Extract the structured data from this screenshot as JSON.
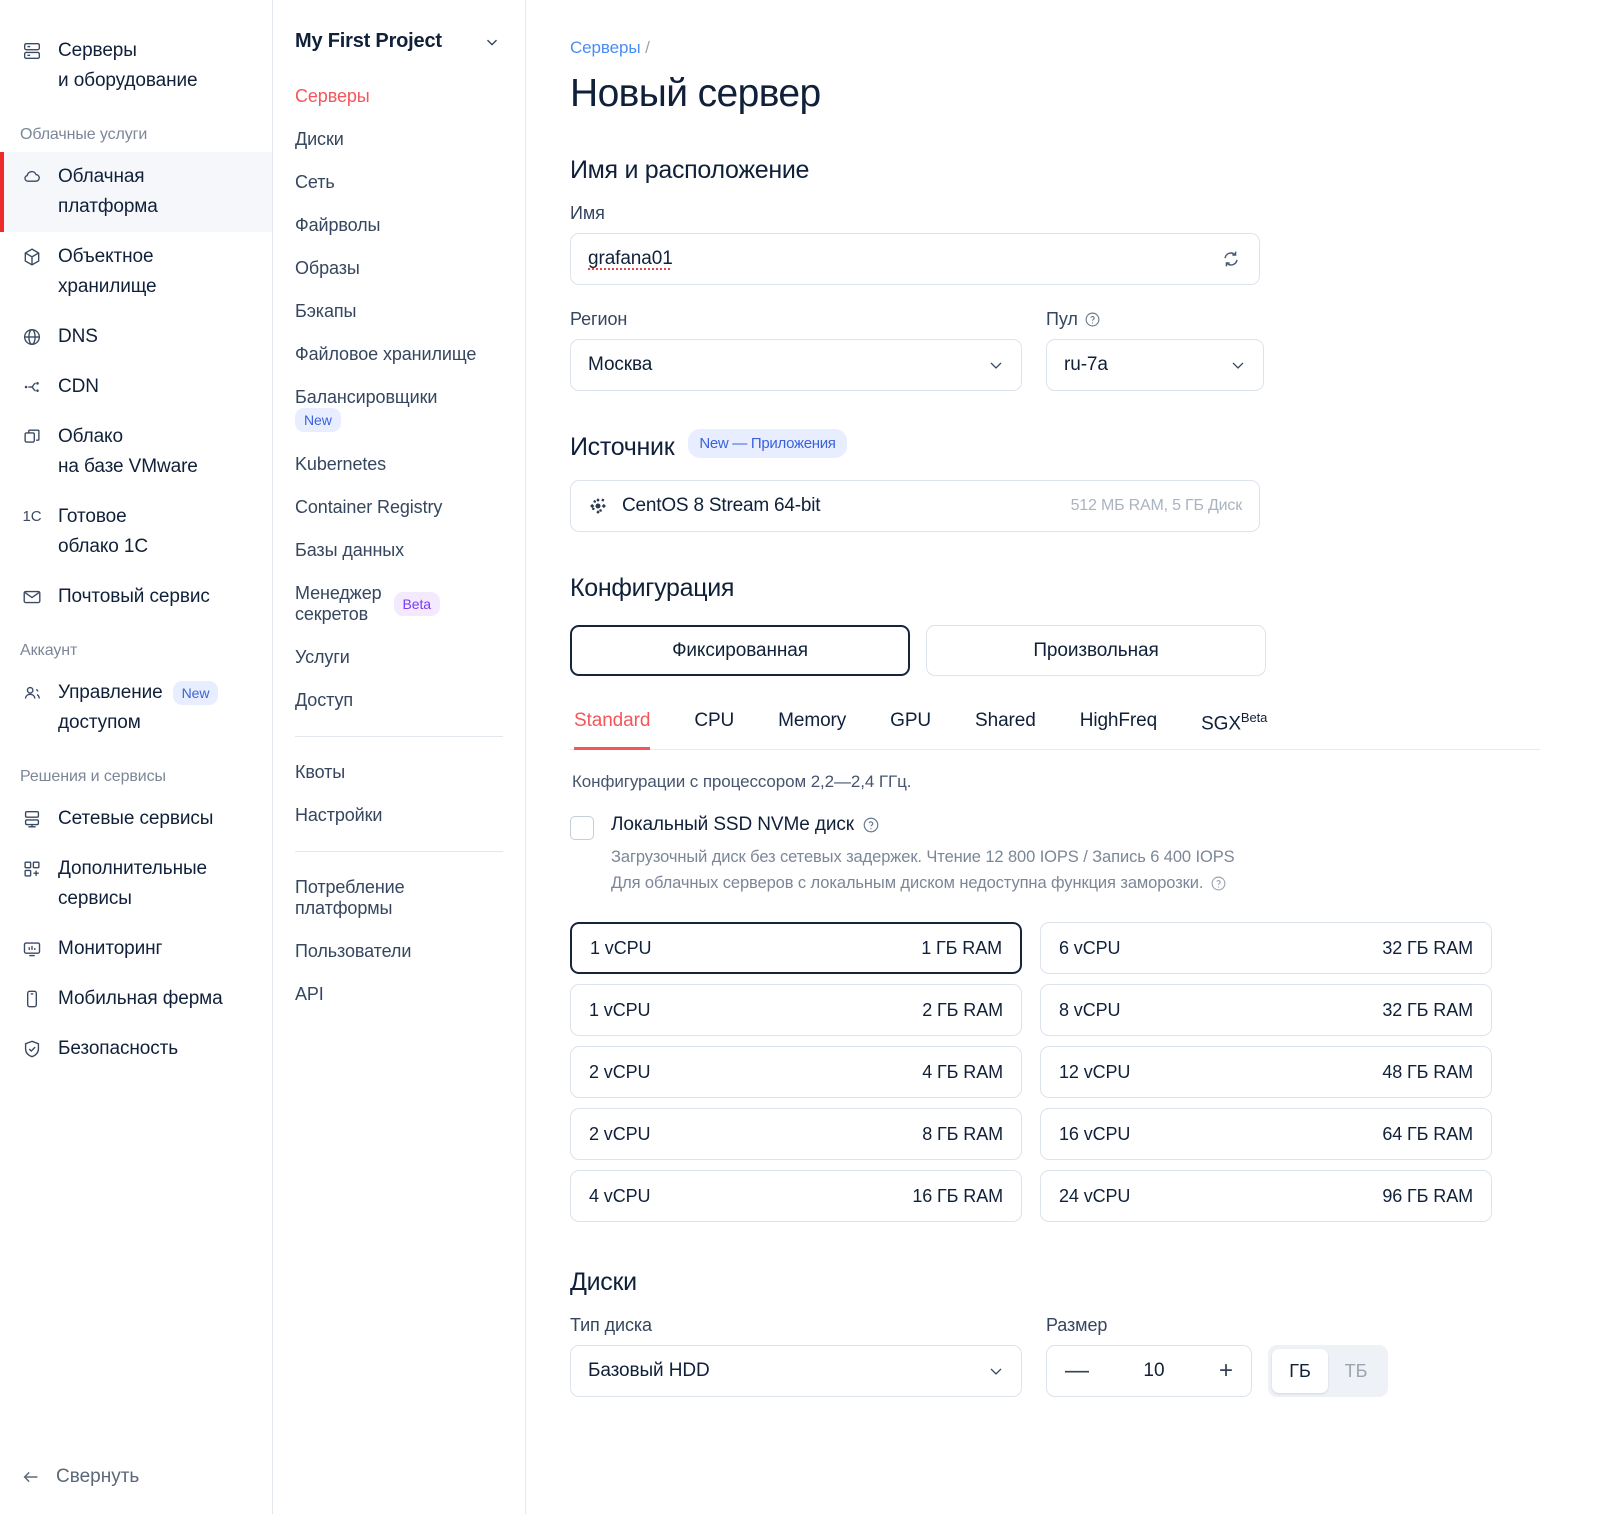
{
  "sidebar": {
    "top_items": [
      {
        "label": "Серверы\nи оборудование",
        "icon": "server-icon"
      }
    ],
    "groups": [
      {
        "title": "Облачные услуги",
        "items": [
          {
            "label": "Облачная\nплатформа",
            "icon": "cloud-icon",
            "active": true
          },
          {
            "label": "Объектное\nхранилище",
            "icon": "box-icon"
          },
          {
            "label": "DNS",
            "icon": "globe-icon"
          },
          {
            "label": "CDN",
            "icon": "cdn-icon"
          },
          {
            "label": "Облако\nна базе VMware",
            "icon": "vmware-icon"
          },
          {
            "label": "Готовое\nоблако 1С",
            "icon": "1c-icon"
          },
          {
            "label": "Почтовый сервис",
            "icon": "mail-icon"
          }
        ]
      },
      {
        "title": "Аккаунт",
        "items": [
          {
            "label": "Управление\nдоступом",
            "icon": "users-icon",
            "badge": "New"
          }
        ]
      },
      {
        "title": "Решения и сервисы",
        "items": [
          {
            "label": "Сетевые сервисы",
            "icon": "network-icon"
          },
          {
            "label": "Дополнительные\nсервисы",
            "icon": "apps-plus-icon"
          },
          {
            "label": "Мониторинг",
            "icon": "monitor-icon"
          },
          {
            "label": "Мобильная ферма",
            "icon": "mobile-icon"
          },
          {
            "label": "Безопасность",
            "icon": "shield-check-icon"
          }
        ]
      }
    ],
    "collapse_label": "Свернуть"
  },
  "project_menu": {
    "title": "My First Project",
    "items": [
      {
        "label": "Серверы",
        "active": true
      },
      {
        "label": "Диски"
      },
      {
        "label": "Сеть"
      },
      {
        "label": "Файрволы"
      },
      {
        "label": "Образы"
      },
      {
        "label": "Бэкапы"
      },
      {
        "label": "Файловое хранилище"
      },
      {
        "label": "Балансировщики",
        "badge": "New",
        "badge_kind": "new"
      },
      {
        "label": "Kubernetes"
      },
      {
        "label": "Container Registry"
      },
      {
        "label": "Базы данных"
      },
      {
        "label": "Менеджер\nсекретов",
        "badge": "Beta",
        "badge_kind": "beta"
      },
      {
        "label": "Услуги"
      },
      {
        "label": "Доступ"
      }
    ],
    "group2": [
      {
        "label": "Квоты"
      },
      {
        "label": "Настройки"
      }
    ],
    "group3": [
      {
        "label": "Потребление\nплатформы"
      },
      {
        "label": "Пользователи"
      },
      {
        "label": "API"
      }
    ]
  },
  "main": {
    "breadcrumb": {
      "link": "Серверы",
      "separator": "/"
    },
    "page_title": "Новый сервер",
    "name_location": {
      "section_title": "Имя и расположение",
      "name_label": "Имя",
      "name_value": "grafana01",
      "regenerate_icon": "refresh-icon",
      "region_label": "Регион",
      "region_value": "Москва",
      "pool_label": "Пул",
      "pool_help_icon": "help-circle-icon",
      "pool_value": "ru-7a"
    },
    "source": {
      "section_title": "Источник",
      "badge": "New — Приложения",
      "os_icon": "centos-icon",
      "os_name": "CentOS 8 Stream 64-bit",
      "os_meta": "512 МБ RAM, 5 ГБ Диск"
    },
    "configuration": {
      "section_title": "Конфигурация",
      "segments": [
        {
          "label": "Фиксированная",
          "active": true
        },
        {
          "label": "Произвольная",
          "active": false
        }
      ],
      "tabs": [
        {
          "label": "Standard",
          "active": true
        },
        {
          "label": "CPU"
        },
        {
          "label": "Memory"
        },
        {
          "label": "GPU"
        },
        {
          "label": "Shared"
        },
        {
          "label": "HighFreq"
        },
        {
          "label": "SGX",
          "sup": "Beta"
        }
      ],
      "hint": "Конфигурации с процессором 2,2—2,4 ГГц.",
      "local_ssd": {
        "label": "Локальный SSD NVMe диск",
        "help_icon": "help-circle-icon",
        "checked": false,
        "desc_line1": "Загрузочный диск без сетевых задержек. Чтение 12 800 IOPS / Запись 6 400 IOPS",
        "desc_line2": "Для облачных серверов с локальным диском недоступна функция заморозки."
      },
      "flavors_left": [
        {
          "cpu": "1 vCPU",
          "ram": "1 ГБ RAM",
          "active": true
        },
        {
          "cpu": "1 vCPU",
          "ram": "2 ГБ RAM"
        },
        {
          "cpu": "2 vCPU",
          "ram": "4 ГБ RAM"
        },
        {
          "cpu": "2 vCPU",
          "ram": "8 ГБ RAM"
        },
        {
          "cpu": "4 vCPU",
          "ram": "16 ГБ RAM"
        }
      ],
      "flavors_right": [
        {
          "cpu": "6 vCPU",
          "ram": "32 ГБ RAM"
        },
        {
          "cpu": "8 vCPU",
          "ram": "32 ГБ RAM"
        },
        {
          "cpu": "12 vCPU",
          "ram": "48 ГБ RAM"
        },
        {
          "cpu": "16 vCPU",
          "ram": "64 ГБ RAM"
        },
        {
          "cpu": "24 vCPU",
          "ram": "96 ГБ RAM"
        }
      ]
    },
    "disks": {
      "section_title": "Диски",
      "type_label": "Тип диска",
      "type_value": "Базовый HDD",
      "size_label": "Размер",
      "size_value": "10",
      "minus": "—",
      "plus": "+",
      "units": [
        {
          "label": "ГБ",
          "active": true
        },
        {
          "label": "ТБ",
          "active": false
        }
      ]
    }
  },
  "colors": {
    "accent_red": "#f4565a",
    "active_bar": "#ee2b2b",
    "link_blue": "#4a8df7",
    "badge_new_bg": "#e8eeff",
    "badge_new_fg": "#3a63d8",
    "badge_beta_bg": "#f3eaff",
    "badge_beta_fg": "#7d3cf0",
    "text": "#102039",
    "muted": "#7b8798",
    "border": "#dde3ec"
  }
}
